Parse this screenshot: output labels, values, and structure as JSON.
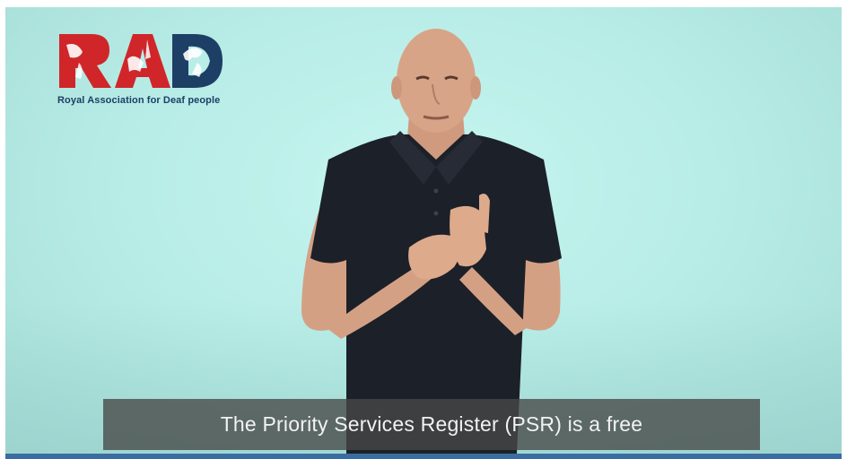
{
  "logo": {
    "wordmark": "RAD",
    "tagline": "Royal Association for Deaf people"
  },
  "caption": {
    "text": "The Priority Services Register (PSR) is a free"
  },
  "colors": {
    "background": "#b8ede8",
    "brand_red": "#d0262a",
    "brand_blue": "#1d3f66",
    "caption_bg": "#464846",
    "progress": "#3a6ea3"
  },
  "video": {
    "progress_percent": 0
  }
}
